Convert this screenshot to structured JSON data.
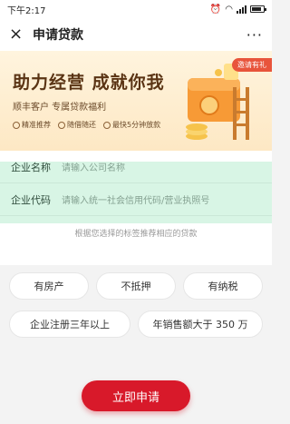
{
  "status_bar": {
    "time": "下午2:17"
  },
  "nav": {
    "close_icon": "×",
    "title": "申请贷款",
    "more_icon": "···"
  },
  "banner": {
    "headline": "助力经营  成就你我",
    "subtitle": "顺丰客户 专属贷款福利",
    "features": [
      "精准推荐",
      "随借随还",
      "最快5分钟放款"
    ],
    "invite_badge": "邀请有礼"
  },
  "form": {
    "company_name": {
      "label": "企业名称",
      "placeholder": "请输入公司名称"
    },
    "company_code": {
      "label": "企业代码",
      "placeholder": "请输入统一社会信用代码/营业执照号"
    },
    "hint": "根据您选择的标签推荐相应的贷款"
  },
  "tags": [
    "有房产",
    "不抵押",
    "有纳税",
    "企业注册三年以上",
    "年销售额大于 350 万"
  ],
  "apply_button": "立即申请",
  "colors": {
    "brand_red": "#d8192a",
    "banner_bg": "#fde8c4"
  }
}
